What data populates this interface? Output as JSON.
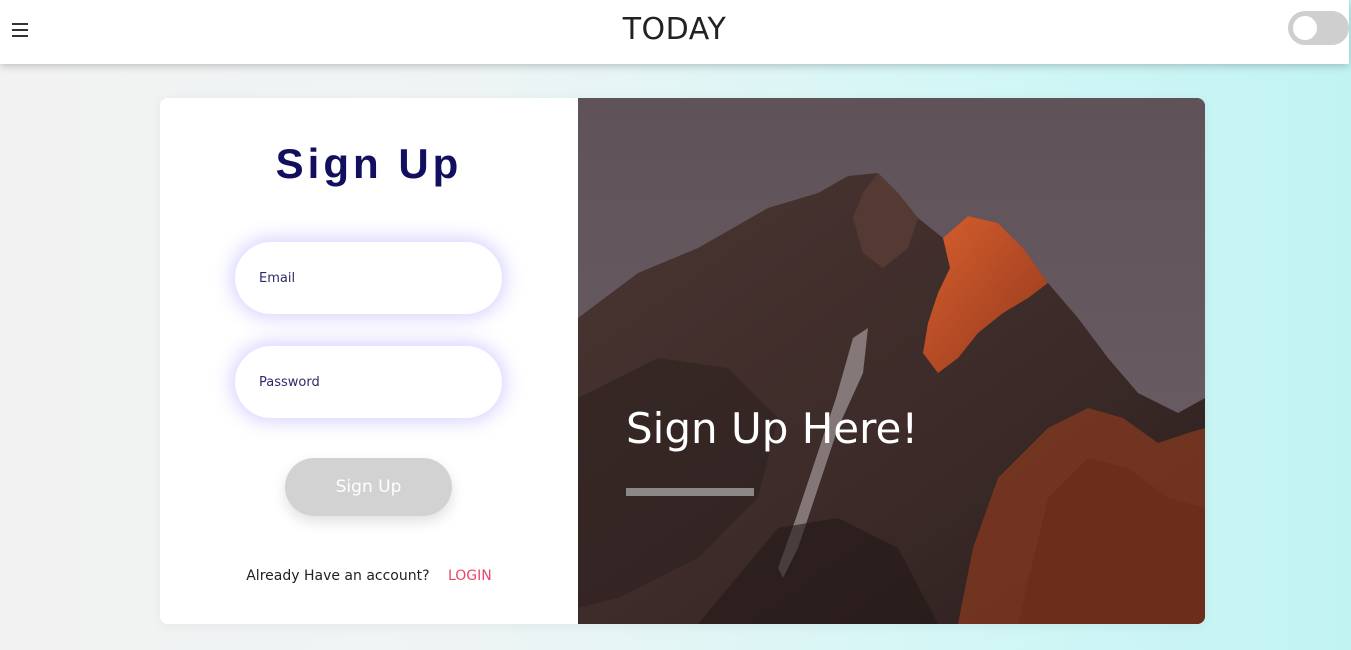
{
  "navbar": {
    "brand": "TODAY",
    "menu_icon": "hamburger-menu-icon",
    "theme_toggle_on": false
  },
  "form": {
    "title": "Sign Up",
    "email_placeholder": "Email",
    "password_placeholder": "Password",
    "submit_label": "Sign Up",
    "already_text": "Already Have an account?",
    "login_label": "LOGIN"
  },
  "hero": {
    "heading": "Sign Up Here!"
  },
  "colors": {
    "title": "#12105e",
    "login_link": "#e8456b",
    "button_bg": "#d2d2d2",
    "input_glow": "#8278ff"
  }
}
